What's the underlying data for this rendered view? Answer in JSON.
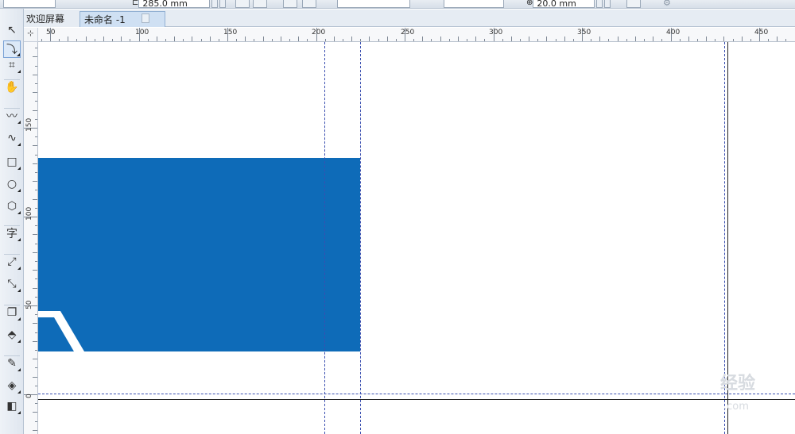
{
  "propbar": {
    "width_value": "285.0 mm",
    "offset_value": "20.0 mm"
  },
  "tabs": {
    "welcome": "欢迎屏幕",
    "document": "未命名 -1"
  },
  "ruler_corner_glyph": "⊹",
  "toolbox": {
    "tools": [
      {
        "name": "pick-tool-icon",
        "glyph": "↖"
      },
      {
        "name": "shape-tool-icon",
        "glyph": "⤵"
      },
      {
        "name": "crop-tool-icon",
        "glyph": "⌗"
      },
      {
        "name": "pan-tool-icon",
        "glyph": "✋"
      },
      {
        "name": "freehand-tool-icon",
        "glyph": "〰"
      },
      {
        "name": "artistic-media-icon",
        "glyph": "∿"
      },
      {
        "name": "rectangle-tool-icon",
        "glyph": "□"
      },
      {
        "name": "ellipse-tool-icon",
        "glyph": "○"
      },
      {
        "name": "polygon-tool-icon",
        "glyph": "⬡"
      },
      {
        "name": "text-tool-icon",
        "glyph": "字"
      },
      {
        "name": "dimension-tool-icon",
        "glyph": "⤢"
      },
      {
        "name": "connector-tool-icon",
        "glyph": "⤡"
      },
      {
        "name": "drop-shadow-icon",
        "glyph": "❐"
      },
      {
        "name": "transparency-icon",
        "glyph": "⬘"
      },
      {
        "name": "eyedropper-icon",
        "glyph": "✎"
      },
      {
        "name": "fill-tool-icon",
        "glyph": "◈"
      },
      {
        "name": "smart-fill-icon",
        "glyph": "◧"
      }
    ]
  },
  "hruler": {
    "labels": [
      "50",
      "100",
      "150",
      "200",
      "250",
      "300",
      "350",
      "400",
      "450"
    ]
  },
  "vruler": {
    "labels": [
      "150",
      "100",
      "50",
      "0"
    ]
  },
  "watermark": {
    "text": "经验",
    "subtext": ".com"
  },
  "colors": {
    "blue_rect": "#0e6bb8",
    "guide": "#3a4fb0"
  }
}
